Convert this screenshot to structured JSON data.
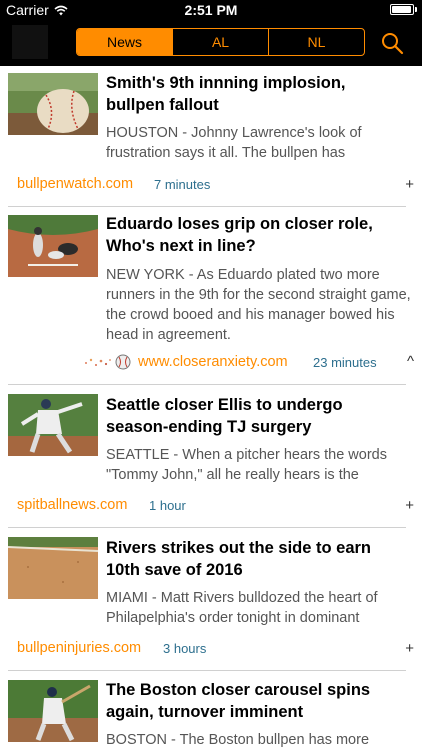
{
  "status": {
    "carrier": "Carrier",
    "time": "2:51 PM",
    "battery_level": 0.95
  },
  "nav": {
    "logo_icon": "app-logo",
    "tabs": [
      {
        "label": "News",
        "active": true
      },
      {
        "label": "AL",
        "active": false
      },
      {
        "label": "NL",
        "active": false
      }
    ],
    "search_icon": "search-icon",
    "accent_color": "#ff8c00"
  },
  "articles": [
    {
      "headline": "Smith's 9th innning implosion, bullpen fallout",
      "snippet": "HOUSTON - Johnny Lawrence's look of frustration says it all. The bullpen has",
      "source": "bullpenwatch.com",
      "time": "7 minutes",
      "toggle": "+",
      "thumb_icon": "baseball-photo"
    },
    {
      "headline": "Eduardo loses grip on closer role, Who's next in line?",
      "snippet": "NEW YORK - As Eduardo plated two more runners in the 9th for the second straight game, the crowd booed and his manager bowed his head in agreement.",
      "source": "www.closeranxiety.com",
      "time": "23 minutes",
      "toggle": "^",
      "thumb_icon": "play-at-plate-photo",
      "source_icon": "baseball-icon"
    },
    {
      "headline": "Seattle closer Ellis to undergo season-ending TJ surgery",
      "snippet": "SEATTLE - When a pitcher hears the words \"Tommy John,\" all he really hears is the",
      "source": "spitballnews.com",
      "time": "1 hour",
      "toggle": "+",
      "thumb_icon": "pitcher-photo"
    },
    {
      "headline": "Rivers strikes out the side to earn 10th save of 2016",
      "snippet": "MIAMI - Matt Rivers bulldozed the heart of Philapelphia's order tonight in dominant",
      "source": "bullpeninjuries.com",
      "time": "3 hours",
      "toggle": "+",
      "thumb_icon": "infield-dirt-photo"
    },
    {
      "headline": "The Boston closer carousel spins again, turnover imminent",
      "snippet": "BOSTON - The Boston bullpen has more",
      "source": "",
      "time": "",
      "toggle": "",
      "thumb_icon": "batter-photo"
    }
  ]
}
